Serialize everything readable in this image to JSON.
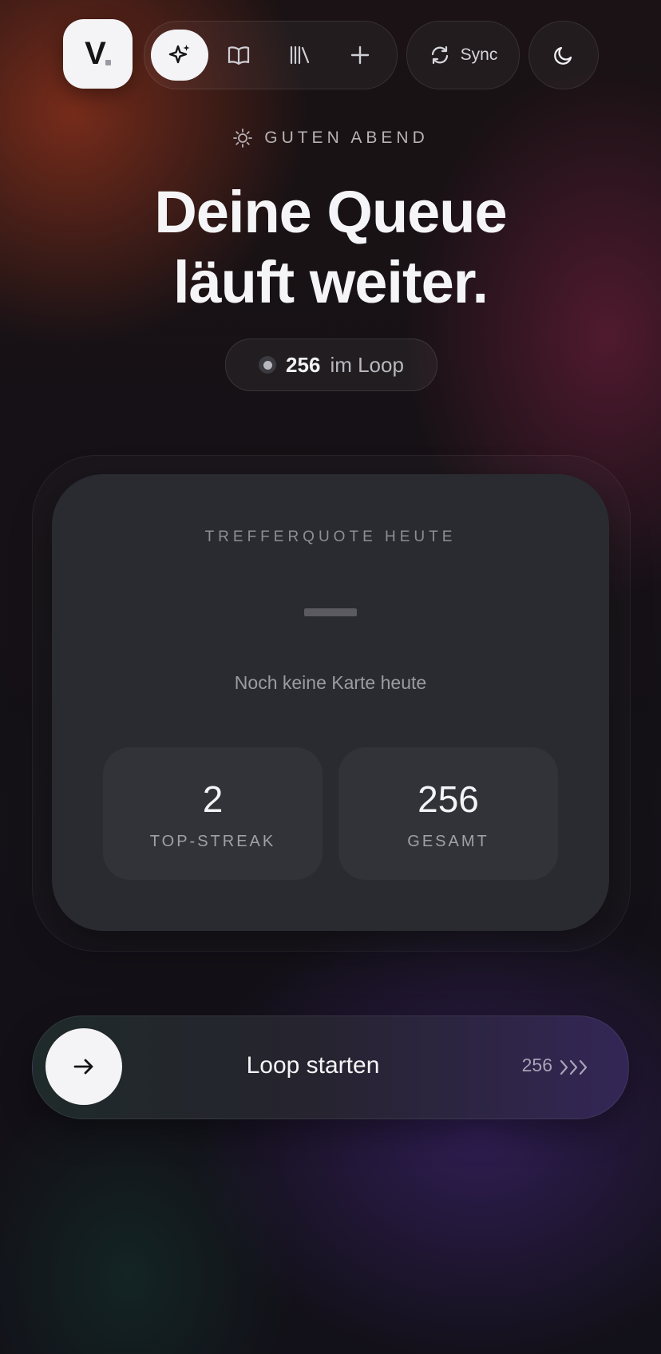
{
  "nav": {
    "logo_letter": "V",
    "items": [
      {
        "icon": "sparkles-icon",
        "active": true
      },
      {
        "icon": "book-icon",
        "active": false
      },
      {
        "icon": "library-icon",
        "active": false
      },
      {
        "icon": "plus-icon",
        "active": false
      }
    ],
    "sync_label": "Sync",
    "theme_icon": "moon-icon"
  },
  "hero": {
    "greeting": "GUTEN ABEND",
    "greeting_icon": "sun-icon",
    "headline_line1": "Deine Queue",
    "headline_line2": "läuft weiter.",
    "loop_count": "256",
    "loop_label": "im Loop"
  },
  "stats": {
    "title": "TREFFERQUOTE HEUTE",
    "empty_text": "Noch keine Karte heute",
    "top_streak_value": "2",
    "top_streak_label": "TOP-STREAK",
    "total_value": "256",
    "total_label": "GESAMT"
  },
  "start": {
    "label": "Loop starten",
    "count": "256",
    "accent_color": "#332656"
  }
}
